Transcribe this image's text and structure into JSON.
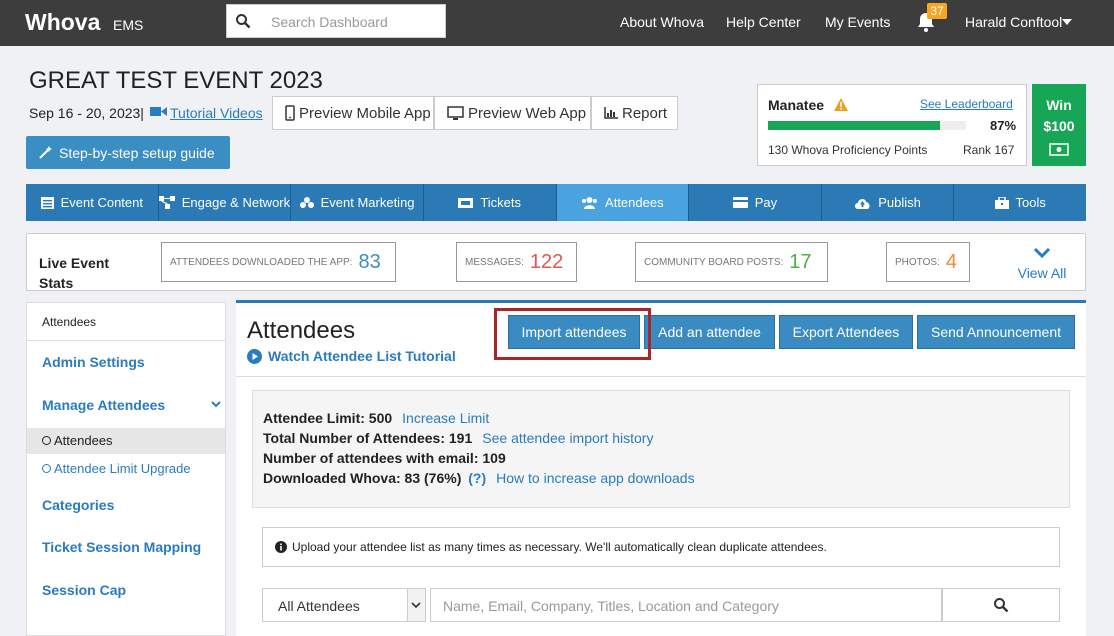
{
  "header": {
    "logo": "Whova",
    "logo_sub": "EMS",
    "search_placeholder": "Search Dashboard",
    "nav": [
      "About Whova",
      "Help Center",
      "My Events"
    ],
    "notification_count": "37",
    "user_name": "Harald Conftool"
  },
  "event": {
    "title": "GREAT TEST EVENT 2023",
    "dates": "Sep 16 - 20, 2023|",
    "tutorial_link": "Tutorial Videos",
    "preview_mobile": "Preview Mobile App",
    "preview_web": "Preview Web App",
    "report": "Report",
    "setup_guide": "Step-by-step setup guide"
  },
  "leaderboard": {
    "name": "Manatee",
    "see_link": "See Leaderboard",
    "percent_text": "87%",
    "percent_value": 0.87,
    "points": "130 Whova Proficiency Points",
    "rank": "Rank 167",
    "win_label": "Win",
    "win_amount": "$100",
    "progress_color": "#17a556"
  },
  "tabs": [
    {
      "label": "Event Content",
      "icon": "list-icon"
    },
    {
      "label": "Engage & Network",
      "icon": "network-icon"
    },
    {
      "label": "Event Marketing",
      "icon": "marketing-icon"
    },
    {
      "label": "Tickets",
      "icon": "ticket-icon"
    },
    {
      "label": "Attendees",
      "icon": "users-icon",
      "active": true
    },
    {
      "label": "Pay",
      "icon": "card-icon"
    },
    {
      "label": "Publish",
      "icon": "cloud-upload-icon"
    },
    {
      "label": "Tools",
      "icon": "toolbox-icon"
    }
  ],
  "stats": {
    "title": "Live Event Stats",
    "items": [
      {
        "label": "ATTENDEES DOWNLOADED THE APP:",
        "value": "83",
        "color": "#3b8ec4"
      },
      {
        "label": "MESSAGES:",
        "value": "122",
        "color": "#e0584b"
      },
      {
        "label": "COMMUNITY BOARD POSTS:",
        "value": "17",
        "color": "#4cae4c"
      },
      {
        "label": "PHOTOS:",
        "value": "4",
        "color": "#f0883a"
      }
    ],
    "view_all": "View All"
  },
  "sidebar": {
    "header": "Attendees",
    "items": [
      "Admin Settings",
      "Manage Attendees",
      "Categories",
      "Ticket Session Mapping",
      "Session Cap"
    ],
    "sub_items": [
      "Attendees",
      "Attendee Limit Upgrade"
    ]
  },
  "main": {
    "title": "Attendees",
    "tutorial": "Watch Attendee List Tutorial",
    "buttons": [
      "Import attendees",
      "Add an attendee",
      "Export Attendees",
      "Send Announcement"
    ],
    "info": [
      {
        "label": "Attendee Limit: 500",
        "link": "Increase Limit"
      },
      {
        "label": "Total Number of Attendees: 191",
        "link": "See attendee import history"
      },
      {
        "label": "Number of attendees with email: 109",
        "link": ""
      },
      {
        "label": "Downloaded Whova: 83 (76%)",
        "help": "(?)",
        "link": "How to increase app downloads"
      }
    ],
    "notice": "Upload your attendee list as many times as necessary. We'll automatically clean duplicate attendees.",
    "filter_value": "All Attendees",
    "search_placeholder": "Name, Email, Company, Titles, Location and Category"
  }
}
